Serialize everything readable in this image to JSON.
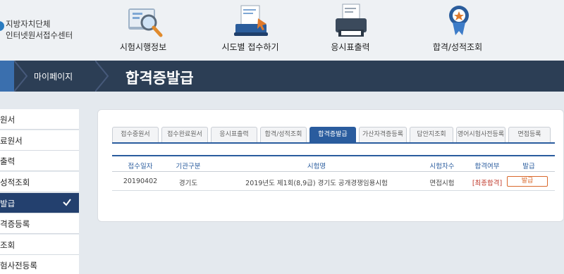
{
  "logo": {
    "line1": "지방자치단체",
    "line2": "인터넷원서접수센터"
  },
  "topnav": [
    {
      "label": "시험시행정보",
      "icon": "magnifier-icon"
    },
    {
      "label": "시도별 접수하기",
      "icon": "laptop-hand-icon"
    },
    {
      "label": "응시표출력",
      "icon": "printer-icon"
    },
    {
      "label": "합격/성적조회",
      "icon": "award-medal-icon"
    }
  ],
  "band": {
    "breadcrumb": "마이페이지",
    "title": "합격증발급"
  },
  "sidebar": {
    "items": [
      {
        "label": "원서"
      },
      {
        "label": "료원서"
      },
      {
        "label": "출력"
      },
      {
        "label": "성적조회"
      },
      {
        "label": "발급"
      },
      {
        "label": "격증등록"
      },
      {
        "label": "조회"
      },
      {
        "label": "험사전등록"
      }
    ]
  },
  "tabs": [
    {
      "label": "접수중원서"
    },
    {
      "label": "접수완료원서"
    },
    {
      "label": "응시표출력"
    },
    {
      "label": "합격/성적조회"
    },
    {
      "label": "합격증발급"
    },
    {
      "label": "가산자격증등록"
    },
    {
      "label": "답안지조회"
    },
    {
      "label": "영어시험사전등록"
    },
    {
      "label": "면접등록"
    }
  ],
  "table": {
    "headers": {
      "date": "접수일자",
      "agency": "기관구분",
      "exam": "시험명",
      "round": "시험차수",
      "result": "합격여부",
      "issue": "발급"
    },
    "rows": [
      {
        "date": "20190402",
        "agency": "경기도",
        "exam": "2019년도 제1회(8,9급) 경기도 공개경쟁임용시험",
        "round": "면접시험",
        "result": "[최종합격]",
        "issue": "발급"
      }
    ]
  },
  "colors": {
    "band": "#2c3e55",
    "accent": "#2a5c9e",
    "sidebar_active": "#23406e",
    "pass": "#c0392b",
    "issue_button": "#d9692c"
  }
}
